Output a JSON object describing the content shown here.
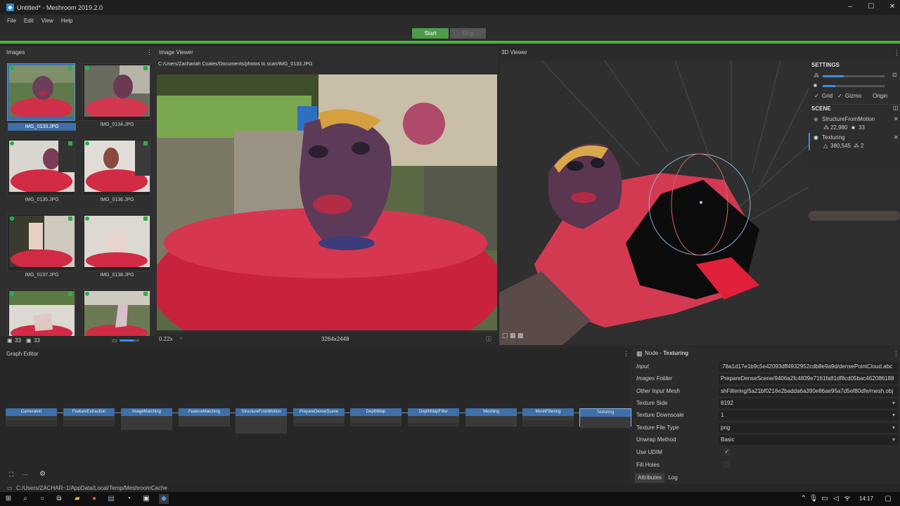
{
  "window": {
    "title": "Untitled* - Meshroom 2019.2.0",
    "logo": "meshroom-logo-icon",
    "controls": [
      "–",
      "☐",
      "✕"
    ]
  },
  "menu": [
    "File",
    "Edit",
    "View",
    "Help"
  ],
  "run": {
    "start": "Start",
    "stop": "Stop"
  },
  "images_panel": {
    "title": "Images",
    "thumbs": [
      {
        "name": "IMG_0133.JPG"
      },
      {
        "name": "IMG_0134.JPG"
      },
      {
        "name": "IMG_0135.JPG"
      },
      {
        "name": "IMG_0136.JPG"
      },
      {
        "name": "IMG_0137.JPG"
      },
      {
        "name": "IMG_0138.JPG"
      },
      {
        "name": ""
      },
      {
        "name": ""
      }
    ],
    "footer_count_a": "33",
    "footer_count_b": "33"
  },
  "image_viewer": {
    "title": "Image Viewer",
    "path": "C:/Users/Zachariah Coates/Documents/photos to scan/IMG_0133.JPG",
    "zoom": "0.22x",
    "resolution": "3264x2448"
  },
  "viewer3d": {
    "title": "3D Viewer",
    "settings_title": "SETTINGS",
    "grid": "Grid",
    "gizmo": "Gizmo",
    "origin": "Origin",
    "scene_title": "SCENE",
    "scene": [
      {
        "name": "StructureFromMotion",
        "a": "22,980",
        "b": "33"
      },
      {
        "name": "Texturing",
        "a": "380,545",
        "b": "2"
      }
    ]
  },
  "graph": {
    "title": "Graph Editor",
    "nodes": [
      "CameraInit",
      "FeatureExtraction",
      "ImageMatching",
      "FeatureMatching",
      "StructureFromMotion",
      "PrepareDenseScene",
      "DepthMap",
      "DepthMapFilter",
      "Meshing",
      "MeshFiltering",
      "Texturing"
    ]
  },
  "node_panel": {
    "prefix": "Node - ",
    "name": "Texturing",
    "attrs": [
      {
        "label": "Input",
        "value": ":78a1d17e1b9c5e42093dff4932952cdb8e9a9d/densePointCloud.abc"
      },
      {
        "label": "Images Folder",
        "value": "PrepareDenseScene/9406a2fc4839e7161fa81df8cd05bac462086188"
      },
      {
        "label": "Other Input Mesh",
        "value": "shFiltering/5a21bf0216e2badda6a390e86ae95a7d5ef80dfe/mesh.obj"
      },
      {
        "label": "Texture Side",
        "value": "8192"
      },
      {
        "label": "Texture Downscale",
        "value": "1"
      },
      {
        "label": "Texture File Type",
        "value": "png"
      },
      {
        "label": "Unwrap Method",
        "value": "Basic"
      },
      {
        "label": "Use UDIM",
        "value": "✓"
      },
      {
        "label": "Fill Holes",
        "value": ""
      }
    ],
    "tabs": [
      "Attributes",
      "Log"
    ]
  },
  "status": {
    "path": "C:/Users/ZACHAR~1/AppData/Local/Temp/MeshroomCache"
  },
  "taskbar": {
    "time": "14:17"
  }
}
